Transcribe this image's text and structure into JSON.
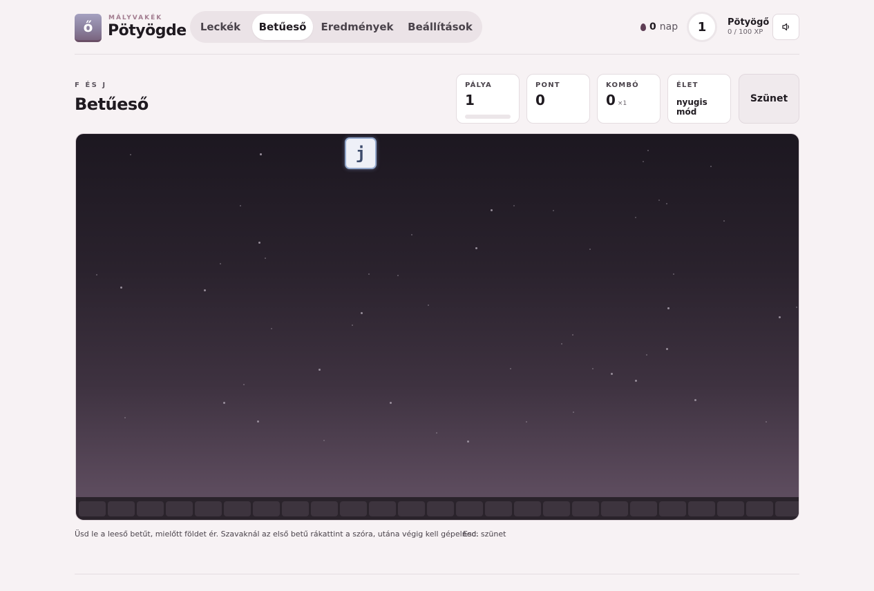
{
  "brand": {
    "small": "MÁLYVAKÉK",
    "name": "Pötyögde",
    "logo_glyph": "ő"
  },
  "nav": {
    "tabs": [
      {
        "label": "Leckék",
        "active": false
      },
      {
        "label": "Betűeső",
        "active": true
      },
      {
        "label": "Eredmények",
        "active": false
      },
      {
        "label": "Beállítások",
        "active": false
      }
    ]
  },
  "status": {
    "streak_count": "0",
    "streak_unit": "nap",
    "level": "1",
    "rank_name": "Pötyögő",
    "xp": "0 / 100 XP",
    "sound_icon": "speaker-icon"
  },
  "page": {
    "subtitle": "F ÉS J",
    "title": "Betűeső"
  },
  "stats": {
    "level": {
      "label": "PÁLYA",
      "value": "1",
      "progress": 0
    },
    "score": {
      "label": "PONT",
      "value": "0"
    },
    "combo": {
      "label": "KOMBÓ",
      "value": "0",
      "multiplier": "×1"
    },
    "lives": {
      "label": "ÉLET",
      "value": "nyugis mód"
    },
    "pause_label": "Szünet"
  },
  "game": {
    "falling_letter": "j",
    "ground_cells": 25
  },
  "hint": {
    "text": "Üsd le a leeső betűt, mielőtt földet ér. Szavaknál az első betű rákattint a szóra, utána végig kell gépelned.",
    "key": "Esc: szünet"
  },
  "colors": {
    "accent": "#7a5f74",
    "background": "#f7f2f4",
    "sky_top": "#1c1720",
    "sky_bottom": "#604f60",
    "tile_border": "#93a8cc"
  }
}
